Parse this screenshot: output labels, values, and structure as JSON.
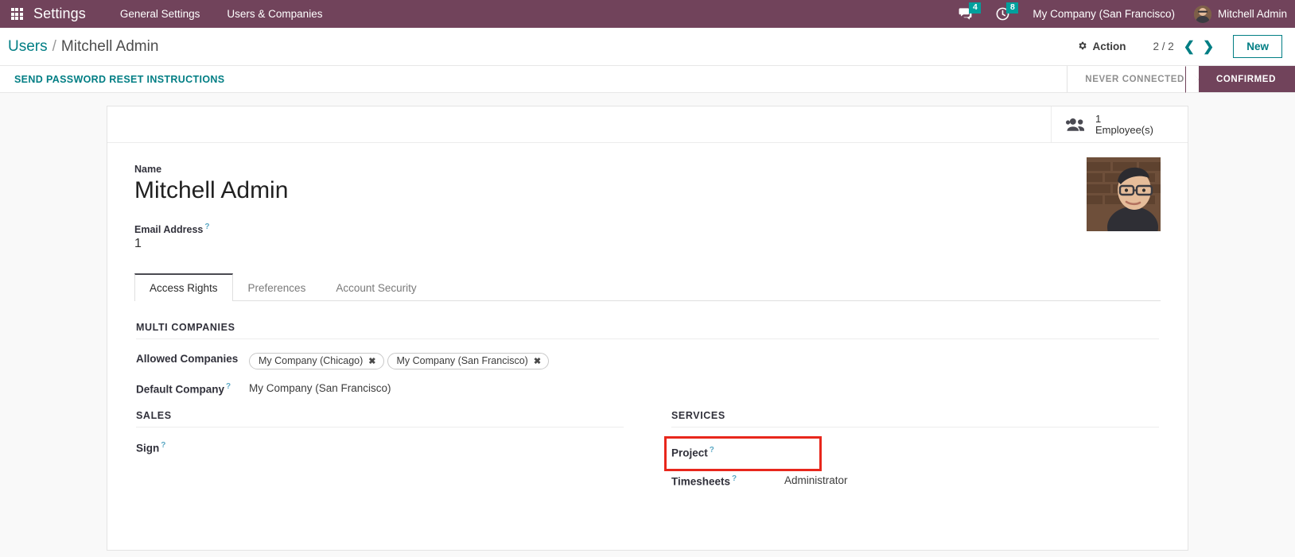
{
  "navbar": {
    "apps_icon": "grid-apps-icon",
    "brand": "Settings",
    "menus": [
      {
        "label": "General Settings"
      },
      {
        "label": "Users & Companies"
      }
    ],
    "systray": {
      "messages_icon": "chat-bubble-icon",
      "messages_count": "4",
      "activities_icon": "clock-icon",
      "activities_count": "8",
      "company": "My Company (San Francisco)",
      "user_name": "Mitchell Admin",
      "avatar": "user-avatar"
    },
    "accent_color": "#71435b",
    "badge_color": "#00A09D"
  },
  "control_panel": {
    "breadcrumb_root": "Users",
    "breadcrumb_sep": "/",
    "breadcrumb_current": "Mitchell Admin",
    "action_icon": "gear-icon",
    "action_label": "Action",
    "pager": "2 / 2",
    "prev_icon": "chevron-left-icon",
    "next_icon": "chevron-right-icon",
    "new_label": "New",
    "link_color": "#017e84"
  },
  "status_bar": {
    "send_password_reset": "SEND PASSWORD RESET INSTRUCTIONS",
    "stages": [
      {
        "label": "NEVER CONNECTED",
        "active": false
      },
      {
        "label": "CONFIRMED",
        "active": true
      }
    ]
  },
  "stat_button": {
    "icon": "users-group-icon",
    "value": "1",
    "label": "Employee(s)"
  },
  "form": {
    "name_label": "Name",
    "name_value": "Mitchell Admin",
    "email_label": "Email Address",
    "email_help": "?",
    "email_value": "1",
    "avatar": "user-photo"
  },
  "notebook": {
    "tabs": [
      {
        "label": "Access Rights",
        "active": true
      },
      {
        "label": "Preferences",
        "active": false
      },
      {
        "label": "Account Security",
        "active": false
      }
    ]
  },
  "multi_companies": {
    "group_title": "MULTI COMPANIES",
    "allowed_label": "Allowed Companies",
    "allowed_tags": [
      {
        "name": "My Company (Chicago)",
        "remove_icon": "✖"
      },
      {
        "name": "My Company (San Francisco)",
        "remove_icon": "✖"
      }
    ],
    "default_label": "Default Company",
    "default_help": "?",
    "default_value": "My Company (San Francisco)"
  },
  "sales": {
    "group_title": "SALES",
    "rows": [
      {
        "label": "Sign",
        "help": "?",
        "value": ""
      }
    ]
  },
  "services": {
    "group_title": "SERVICES",
    "project_label": "Project",
    "project_help": "?",
    "project_value": "",
    "timesheets_label": "Timesheets",
    "timesheets_help": "?",
    "timesheets_value": "Administrator",
    "highlight_color": "#e8271c"
  }
}
